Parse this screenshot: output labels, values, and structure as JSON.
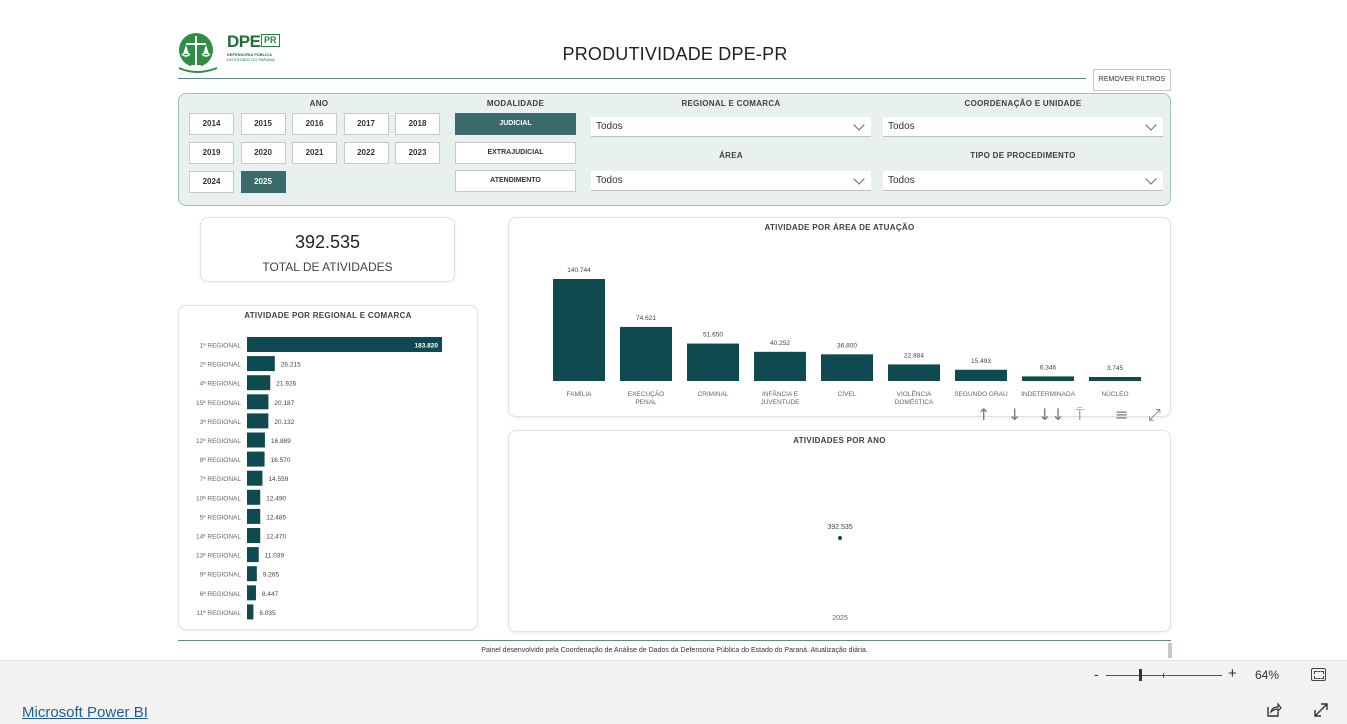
{
  "header": {
    "logo_main": "DPE",
    "logo_badge": "PR",
    "logo_line1": "DEFENSORIA PÚBLICA",
    "logo_line2": "DO ESTADO DO PARANÁ",
    "title": "PRODUTIVIDADE DPE-PR",
    "remove_filters_label": "REMOVER FILTROS"
  },
  "filters": {
    "ano_label": "ANO",
    "years": [
      {
        "label": "2014",
        "selected": false
      },
      {
        "label": "2015",
        "selected": false
      },
      {
        "label": "2016",
        "selected": false
      },
      {
        "label": "2017",
        "selected": false
      },
      {
        "label": "2018",
        "selected": false
      },
      {
        "label": "2019",
        "selected": false
      },
      {
        "label": "2020",
        "selected": false
      },
      {
        "label": "2021",
        "selected": false
      },
      {
        "label": "2022",
        "selected": false
      },
      {
        "label": "2023",
        "selected": false
      },
      {
        "label": "2024",
        "selected": false
      },
      {
        "label": "2025",
        "selected": true
      }
    ],
    "modalidade_label": "MODALIDADE",
    "modalidades": [
      {
        "label": "JUDICIAL",
        "selected": true
      },
      {
        "label": "EXTRAJUDICIAL",
        "selected": false
      },
      {
        "label": "ATENDIMENTO",
        "selected": false
      }
    ],
    "regional_label": "REGIONAL E COMARCA",
    "regional_value": "Todos",
    "coordenacao_label": "COORDENAÇÃO E UNIDADE",
    "coordenacao_value": "Todos",
    "area_label": "ÁREA",
    "area_value": "Todos",
    "tipo_label": "TIPO DE PROCEDIMENTO",
    "tipo_value": "Todos"
  },
  "kpi": {
    "value": "392.535",
    "label": "TOTAL DE ATIVIDADES"
  },
  "chart_data": [
    {
      "type": "bar",
      "orientation": "horizontal",
      "title": "ATIVIDADE POR REGIONAL E COMARCA",
      "categories": [
        "1ª REGIONAL",
        "2ª REGIONAL",
        "4ª REGIONAL",
        "15ª REGIONAL",
        "3ª REGIONAL",
        "12ª REGIONAL",
        "8ª REGIONAL",
        "7ª REGIONAL",
        "10ª REGIONAL",
        "5ª REGIONAL",
        "14ª REGIONAL",
        "13ª REGIONAL",
        "9ª REGIONAL",
        "6ª REGIONAL",
        "11ª REGIONAL"
      ],
      "values": [
        183820,
        26215,
        21926,
        20187,
        20132,
        16889,
        16570,
        14559,
        12490,
        12485,
        12470,
        11039,
        9265,
        8447,
        6035
      ],
      "labels": [
        "183.820",
        "26.215",
        "21.926",
        "20.187",
        "20.132",
        "16.889",
        "16.570",
        "14.559",
        "12.490",
        "12.485",
        "12.470",
        "11.039",
        "9.265",
        "8.447",
        "6.035"
      ],
      "color": "#0e4a50"
    },
    {
      "type": "bar",
      "title": "ATIVIDADE POR ÁREA DE ATUAÇÃO",
      "categories": [
        [
          "FAMÍLIA"
        ],
        [
          "EXECUÇÃO",
          "PENAL"
        ],
        [
          "CRIMINAL"
        ],
        [
          "INFÂNCIA E",
          "JUVENTUDE"
        ],
        [
          "CÍVEL"
        ],
        [
          "VIOLÊNCIA",
          "DOMÉSTICA"
        ],
        [
          "SEGUNDO GRAU"
        ],
        [
          "INDETERMINADA"
        ],
        [
          "NÚCLEO"
        ]
      ],
      "values": [
        140744,
        74621,
        51650,
        40252,
        36800,
        22884,
        15493,
        6346,
        3745
      ],
      "labels": [
        "140.744",
        "74.621",
        "51.650",
        "40.252",
        "36.800",
        "22.884",
        "15.493",
        "6.346",
        "3.745"
      ],
      "color": "#0e4a50"
    },
    {
      "type": "scatter",
      "title": "ATIVIDADES POR ANO",
      "x": [
        "2025"
      ],
      "values": [
        392535
      ],
      "labels": [
        "392.535"
      ],
      "color": "#0e4a50"
    }
  ],
  "toolbar": {
    "icons": [
      "arrow-up-icon",
      "arrow-down-icon",
      "double-arrow-down-icon",
      "expand-hierarchy-icon",
      "filter-icon",
      "focus-mode-icon"
    ]
  },
  "footer": {
    "text": "Painel desenvolvido pela Coordenação de Análise de Dados da Defensoria Pública do Estado do Paraná. Atualização diária."
  },
  "zoom": {
    "minus": "-",
    "plus": "+",
    "percent": "64%",
    "level": 0.64
  },
  "brand": {
    "link": "Microsoft Power BI"
  }
}
